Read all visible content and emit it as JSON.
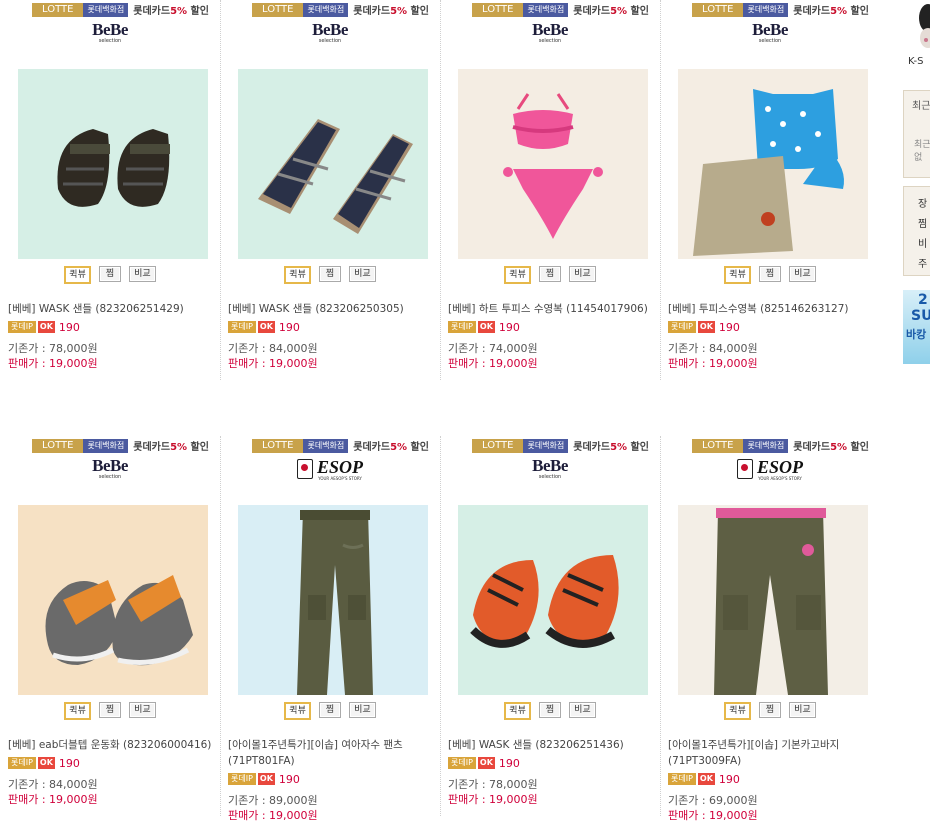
{
  "promo": {
    "lotte": "LOTTE",
    "dept": "롯데백화점",
    "card": "롯데카드",
    "pct": "5%",
    "suffix": "할인"
  },
  "buttons": {
    "quick": "퀵뷰",
    "jjim": "찜",
    "compare": "비교"
  },
  "point_labels": {
    "tip": "롯데IP",
    "ok": "OK"
  },
  "brands": {
    "bebe": {
      "name": "BeBe",
      "sub": "selection"
    },
    "esop": {
      "name": "ESOP",
      "sub": "YOUR AESOP'S STORY"
    }
  },
  "products": [
    {
      "brand": "bebe",
      "name": "[베베] WASK 샌들 (823206251429)",
      "point": "190",
      "orig": "기존가 : 78,000원",
      "sale": "판매가 : 19,000원",
      "image": "black-sandal-icon"
    },
    {
      "brand": "bebe",
      "name": "[베베] WASK 샌들 (823206250305)",
      "point": "190",
      "orig": "기존가 : 84,000원",
      "sale": "판매가 : 19,000원",
      "image": "navy-sandal-icon"
    },
    {
      "brand": "bebe",
      "name": "[베베] 하트 투피스 수영복 (11454017906)",
      "point": "190",
      "orig": "기존가 : 74,000원",
      "sale": "판매가 : 19,000원",
      "image": "pink-swimsuit-icon"
    },
    {
      "brand": "bebe",
      "name": "[베베] 투피스수영복 (825146263127)",
      "point": "190",
      "orig": "기존가 : 84,000원",
      "sale": "판매가 : 19,000원",
      "image": "blue-swimsuit-skirt-icon"
    },
    {
      "brand": "bebe",
      "name": "[베베] eab더블텝 운동화 (823206000416)",
      "point": "190",
      "orig": "기존가 : 84,000원",
      "sale": "판매가 : 19,000원",
      "image": "orange-sneaker-icon"
    },
    {
      "brand": "esop",
      "name": "[아이몰1주년특가][이솝] 여아자수 팬츠 (71PT801FA)",
      "point": "190",
      "orig": "기존가 : 89,000원",
      "sale": "판매가 : 19,000원",
      "image": "khaki-pants-icon"
    },
    {
      "brand": "bebe",
      "name": "[베베] WASK 샌들 (823206251436)",
      "point": "190",
      "orig": "기존가 : 78,000원",
      "sale": "판매가 : 19,000원",
      "image": "orange-sandal-icon"
    },
    {
      "brand": "esop",
      "name": "[아이몰1주년특가][이솝] 기본카고바지 (71PT3009FA)",
      "point": "190",
      "orig": "기존가 : 69,000원",
      "sale": "판매가 : 19,000원",
      "image": "cargo-pants-icon"
    }
  ],
  "sidebar": {
    "ks": "K-S",
    "recent_title": "최근",
    "recent_body": "최근\n없",
    "menu": [
      "장",
      "찜",
      "비",
      "주"
    ],
    "banner": [
      "2",
      "SU",
      "바캉"
    ]
  },
  "colors": {
    "sale": "#d0003a",
    "lotte_gold": "#c8a24a",
    "dept_blue": "#4b5aa0"
  }
}
